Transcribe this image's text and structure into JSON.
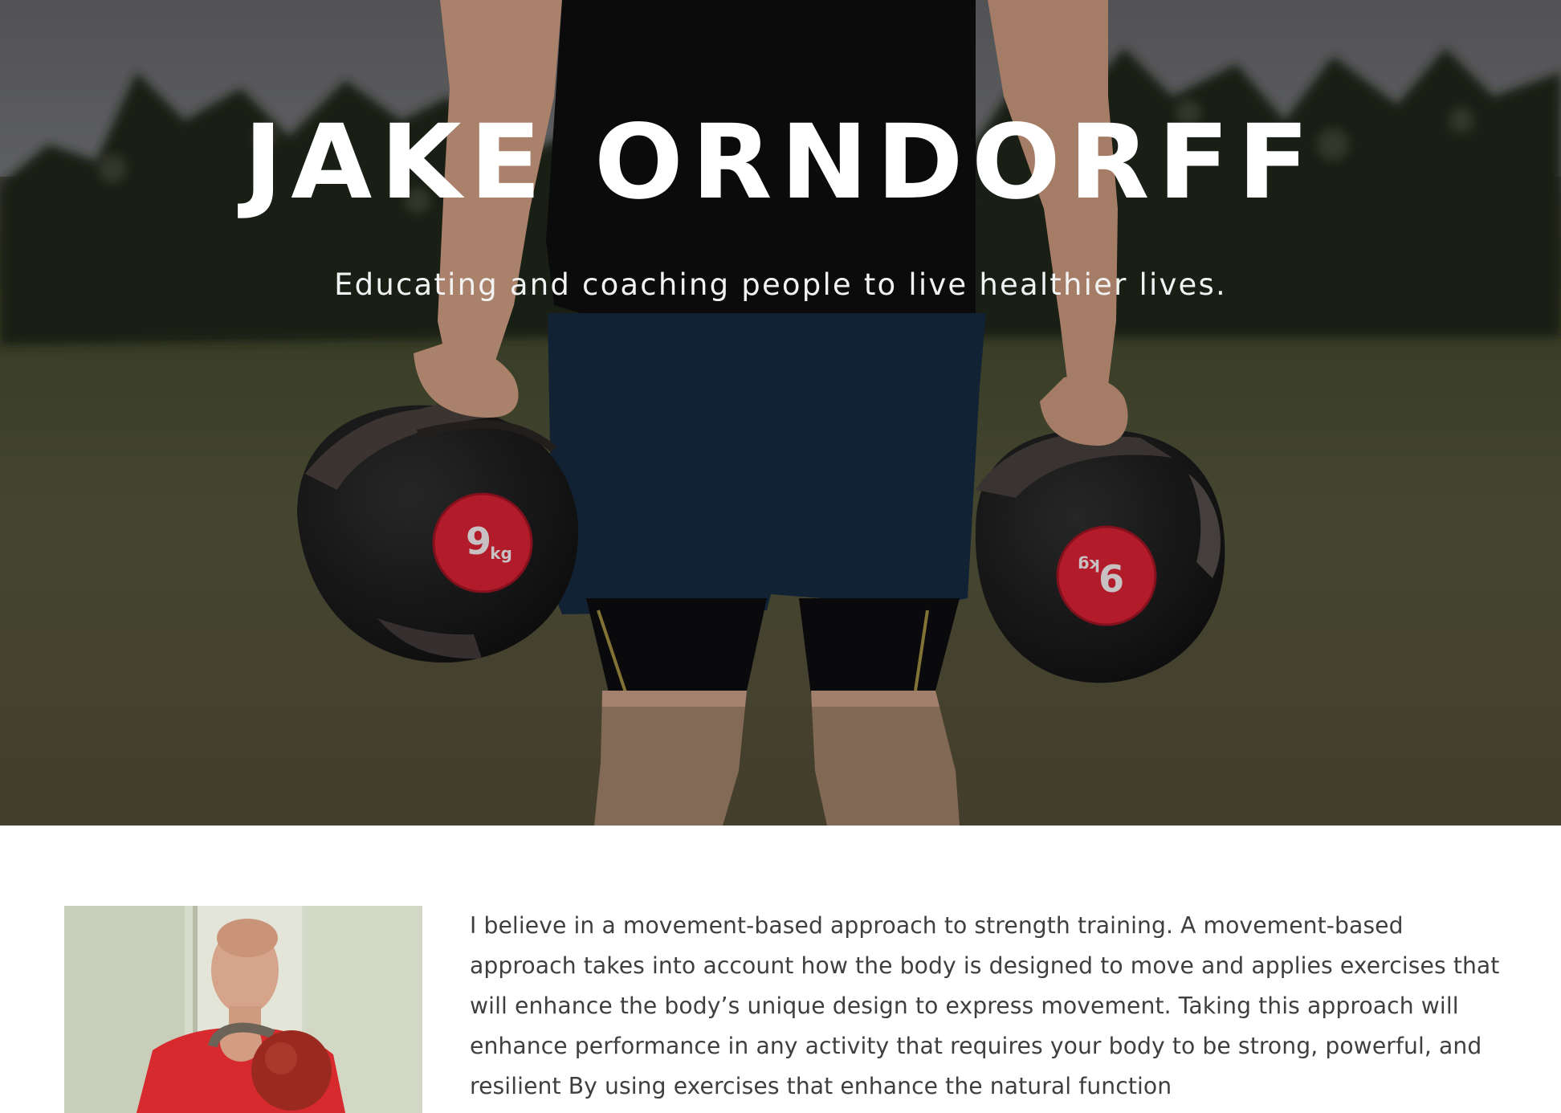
{
  "hero": {
    "title": "JAKE ORNDORFF",
    "subtitle": "Educating and coaching people to live healthier lives.",
    "background_image": "athlete holding two medicine balls in a field",
    "ball_label_number": "9",
    "ball_label_unit": "kg"
  },
  "about": {
    "photo": "man holding red kettlebell",
    "paragraph": "I believe in a movement-based approach to strength training. A movement-based approach takes into account how the body is designed to move and applies exercises that will enhance the body’s unique design to express movement. Taking this approach will enhance performance in any activity that requires your body to be strong, powerful, and resilient By using exercises that enhance the natural function"
  },
  "colors": {
    "hero_text": "#ffffff",
    "body_text": "#3f3f3f",
    "accent_red": "#c4202e"
  }
}
